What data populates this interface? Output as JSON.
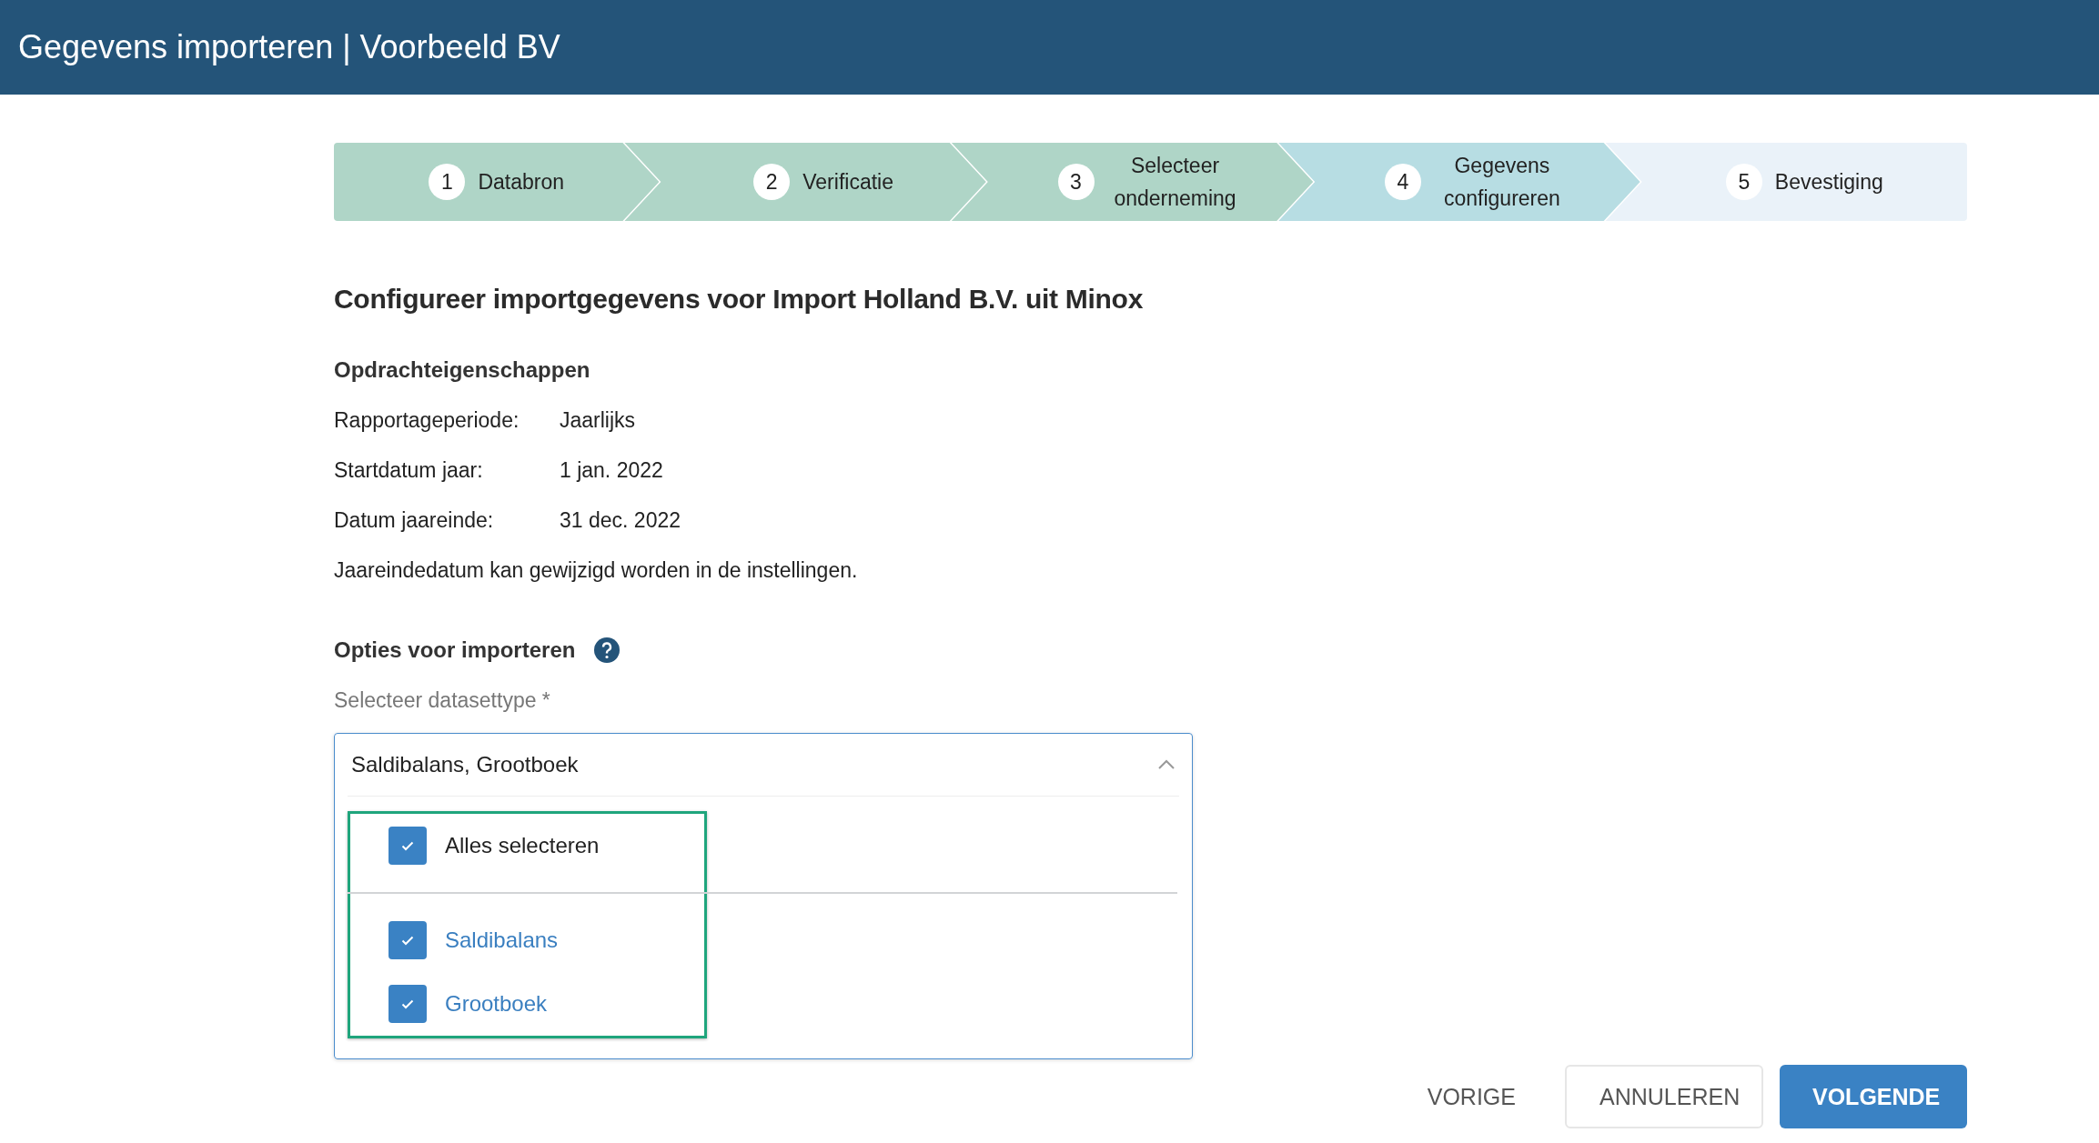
{
  "header": {
    "title": "Gegevens importeren | Voorbeeld BV"
  },
  "steps": [
    {
      "number": "1",
      "label": "Databron",
      "completed": true,
      "selected": false
    },
    {
      "number": "2",
      "label": "Verificatie",
      "completed": true,
      "selected": false
    },
    {
      "number": "3",
      "label": "Selecteer onderneming",
      "completed": true,
      "selected": false
    },
    {
      "number": "4",
      "label": "Gegevens configureren",
      "completed": false,
      "selected": true
    },
    {
      "number": "5",
      "label": "Bevestiging",
      "completed": false,
      "selected": false
    }
  ],
  "heading": "Configureer importgegevens voor Import Holland B.V. uit Minox",
  "properties": {
    "title": "Opdrachteigenschappen",
    "rows": [
      {
        "label": "Rapportageperiode:",
        "value": "Jaarlijks"
      },
      {
        "label": "Startdatum jaar:",
        "value": "1 jan. 2022"
      },
      {
        "label": "Datum jaareinde:",
        "value": "31 dec. 2022"
      }
    ],
    "note": "Jaareindedatum kan gewijzigd worden in de instellingen."
  },
  "options": {
    "title": "Opties voor importeren",
    "field_label": "Selecteer datasettype *",
    "dropdown": {
      "value": "Saldibalans, Grootboek",
      "expanded": true,
      "select_all": {
        "label": "Alles selecteren",
        "checked": true
      },
      "items": [
        {
          "label": "Saldibalans",
          "checked": true
        },
        {
          "label": "Grootboek",
          "checked": true
        }
      ]
    }
  },
  "buttons": [
    {
      "label": "VORIGE",
      "kind": "text"
    },
    {
      "label": "ANNULEREN",
      "kind": "outline"
    },
    {
      "label": "VOLGENDE",
      "kind": "primary"
    }
  ]
}
